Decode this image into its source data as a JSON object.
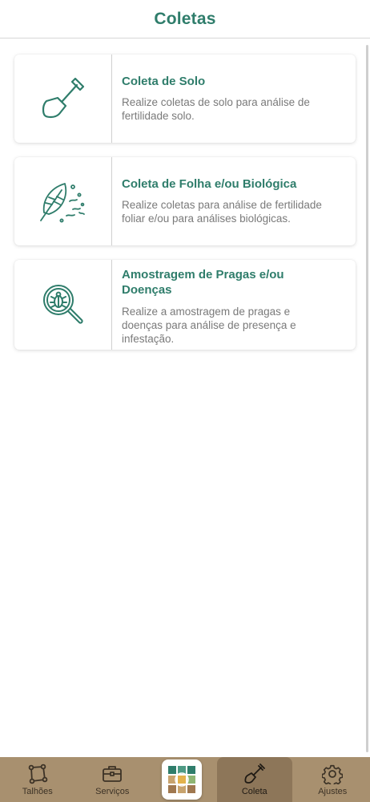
{
  "header": {
    "title": "Coletas"
  },
  "cards": [
    {
      "icon": "shovel-icon",
      "title": "Coleta de Solo",
      "desc_lines": [
        "Realize coletas de solo para análise de",
        "fertilidade solo."
      ]
    },
    {
      "icon": "leaf-bugs-icon",
      "title": "Coleta de Folha e/ou Biológica",
      "desc_lines": [
        "Realize coletas para análise de fertilidade",
        "foliar e/ou para análises biológicas."
      ]
    },
    {
      "icon": "bug-magnifier-icon",
      "title_lines": [
        "Amostragem de Pragas e/ou",
        "Doenças"
      ],
      "desc_lines": [
        "Realize a amostragem de pragas e",
        "doenças para análise de presença e",
        "infestação."
      ]
    }
  ],
  "bottom_nav": {
    "items": [
      {
        "label": "Talhões",
        "icon": "polygon-icon"
      },
      {
        "label": "Serviços",
        "icon": "briefcase-icon"
      },
      {
        "label": "",
        "icon": "app-logo-icon"
      },
      {
        "label": "Coleta",
        "icon": "shovel-icon",
        "active": true
      },
      {
        "label": "Ajustes",
        "icon": "gear-icon"
      }
    ]
  },
  "colors": {
    "accent": "#2f7d6b",
    "nav_background": "#a8906f",
    "nav_active": "#8d7659",
    "text_muted": "#7a7a7a"
  }
}
